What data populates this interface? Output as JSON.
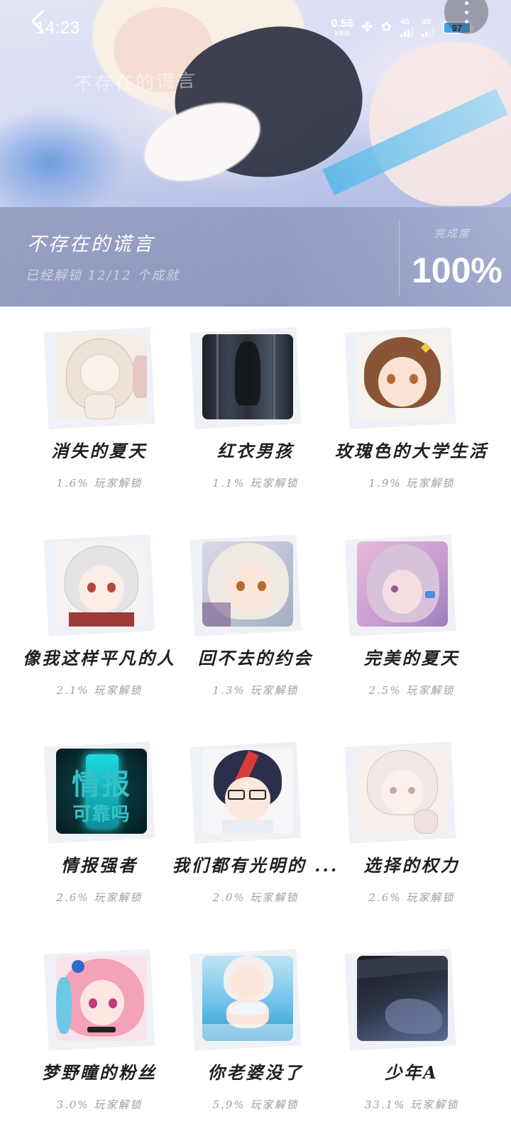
{
  "status_bar": {
    "time": "14:23",
    "net_speed_value": "0.56",
    "net_speed_unit": "KB/S",
    "signal_1": "4G",
    "signal_2": "4G",
    "battery": "97"
  },
  "header": {
    "watermark_text": "不存在的谎言",
    "title": "不存在的谎言",
    "subtitle": "已经解锁 12/12 个成就",
    "completion_label": "完成度",
    "completion_value": "100%"
  },
  "icons": {
    "back": "back-arrow-icon",
    "more": "more-vertical-icon"
  },
  "colors": {
    "title_text": "#1f1f1f",
    "rate_text": "#9a9ea8",
    "battery_fill": "#3fa4ea"
  },
  "achievements": [
    {
      "title": "消失的夏天",
      "rate": "1.6% 玩家解锁"
    },
    {
      "title": "红衣男孩",
      "rate": "1.1% 玩家解锁"
    },
    {
      "title": "玫瑰色的大学生活",
      "rate": "1.9% 玩家解锁"
    },
    {
      "title": "像我这样平凡的人",
      "rate": "2.1% 玩家解锁"
    },
    {
      "title": "回不去的约会",
      "rate": "1.3% 玩家解锁"
    },
    {
      "title": "完美的夏天",
      "rate": "2.5% 玩家解锁"
    },
    {
      "title": "情报强者",
      "rate": "2.6% 玩家解锁",
      "thumb_text_1": "情报",
      "thumb_text_2": "可靠吗"
    },
    {
      "title": "我们都有光明的 ...",
      "rate": "2.0% 玩家解锁"
    },
    {
      "title": "选择的权力",
      "rate": "2.6% 玩家解锁"
    },
    {
      "title": "梦野瞳的粉丝",
      "rate": "3.0% 玩家解锁"
    },
    {
      "title": "你老婆没了",
      "rate": "5.9% 玩家解锁"
    },
    {
      "title": "少年A",
      "rate": "33.1% 玩家解锁"
    }
  ]
}
